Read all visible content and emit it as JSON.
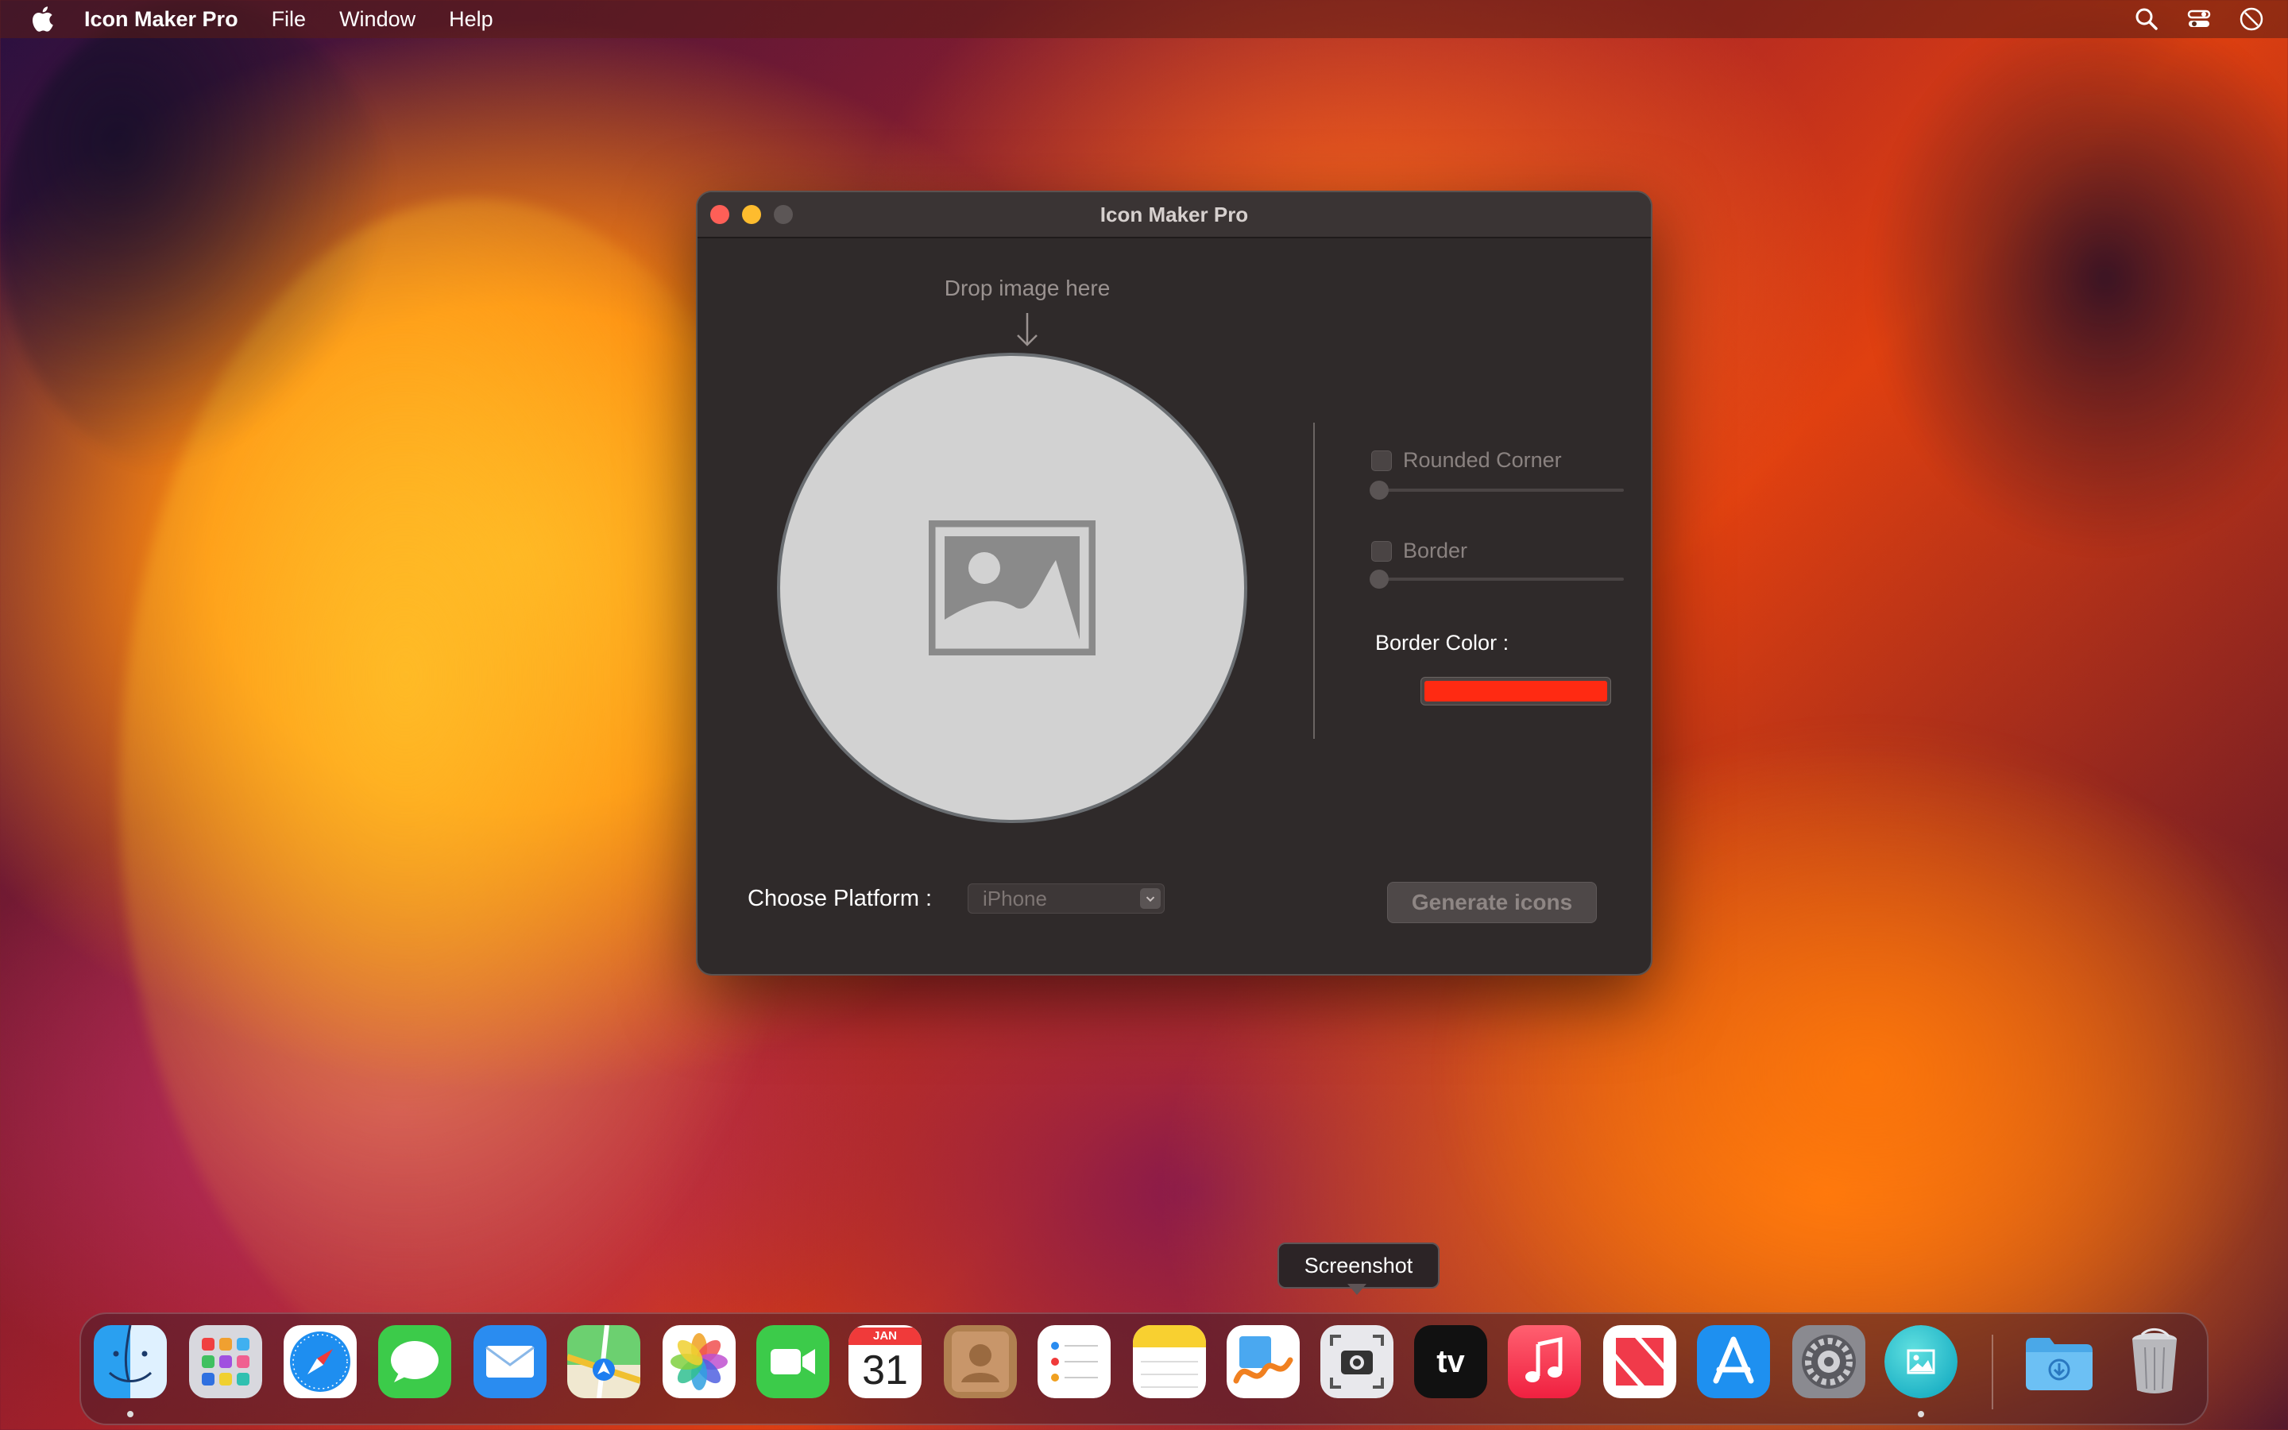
{
  "menubar": {
    "app_name": "Icon Maker Pro",
    "menus": [
      "File",
      "Window",
      "Help"
    ]
  },
  "window": {
    "title": "Icon Maker Pro",
    "drop_hint": "Drop image here",
    "options": {
      "rounded_corner_label": "Rounded Corner",
      "rounded_corner_checked": false,
      "rounded_corner_value": 0,
      "border_label": "Border",
      "border_checked": false,
      "border_value": 0,
      "border_color_label": "Border Color :",
      "border_color": "#ff2a12"
    },
    "platform_label": "Choose Platform :",
    "platform_selected": "iPhone",
    "generate_label": "Generate icons"
  },
  "tooltip": "Screenshot",
  "dock": {
    "calendar_month": "JAN",
    "calendar_day": "31",
    "tv_label": "tv",
    "apps": [
      "finder",
      "launchpad",
      "safari",
      "messages",
      "mail",
      "maps",
      "photos",
      "facetime",
      "calendar",
      "contacts",
      "reminders",
      "notes",
      "freeform",
      "screenshot",
      "apple-tv",
      "music",
      "news",
      "app-store",
      "system-settings",
      "icon-maker-pro",
      "downloads",
      "trash"
    ]
  }
}
